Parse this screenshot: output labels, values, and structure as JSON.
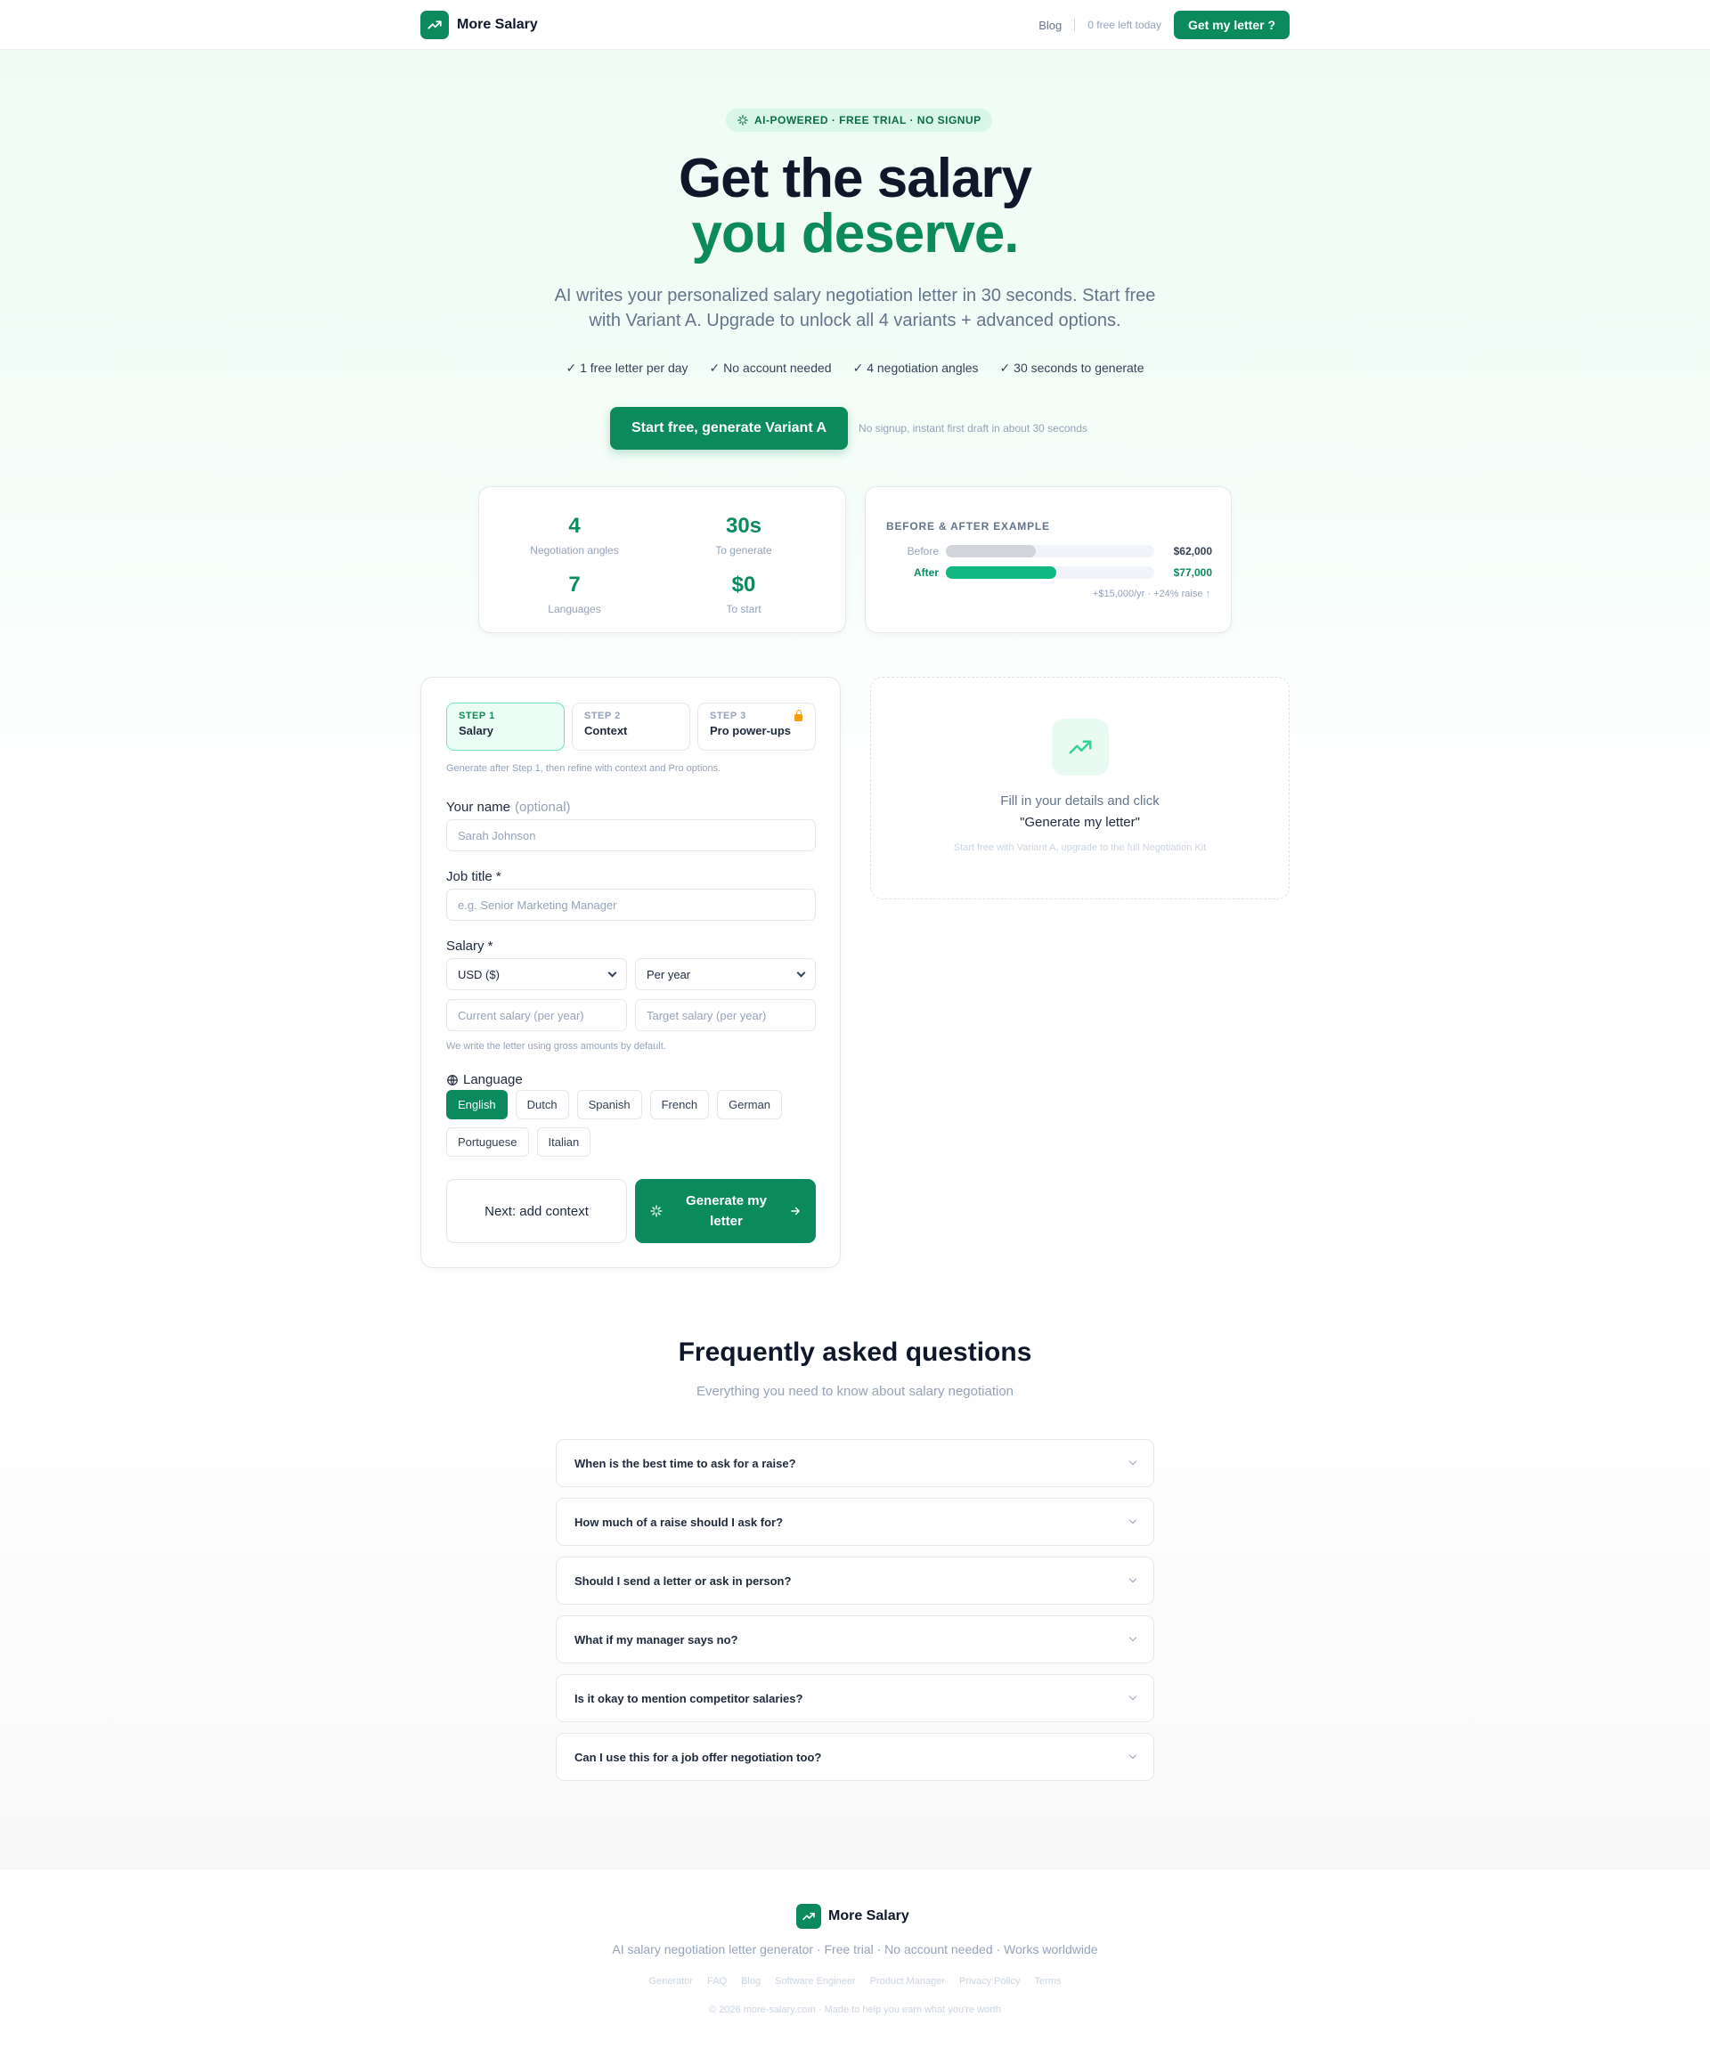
{
  "brand": {
    "name": "More Salary"
  },
  "nav": {
    "blog": "Blog",
    "free_left": "0 free left today",
    "cta": "Get my letter ?"
  },
  "hero": {
    "pill": "AI-POWERED · FREE TRIAL · NO SIGNUP",
    "title_line1": "Get the salary",
    "title_line2": "you deserve.",
    "subtitle": "AI writes your personalized salary negotiation letter in 30 seconds. Start free with Variant A. Upgrade to unlock all 4 variants + advanced options.",
    "checks": [
      "✓ 1 free letter per day",
      "✓ No account needed",
      "✓ 4 negotiation angles",
      "✓ 30 seconds to generate"
    ],
    "cta": "Start free, generate Variant A",
    "cta_note": "No signup, instant first draft in about 30 seconds"
  },
  "stats": [
    {
      "value": "4",
      "label": "Negotiation angles"
    },
    {
      "value": "30s",
      "label": "To generate"
    },
    {
      "value": "7",
      "label": "Languages"
    },
    {
      "value": "$0",
      "label": "To start"
    }
  ],
  "example": {
    "title": "BEFORE & AFTER EXAMPLE",
    "before_label": "Before",
    "before_value": "$62,000",
    "before_fill": 0.43,
    "before_color": "#d1d5db",
    "after_label": "After",
    "after_value": "$77,000",
    "after_fill": 0.53,
    "after_color": "#10b981",
    "note": "+$15,000/yr · +24% raise ↑"
  },
  "form": {
    "steps": [
      {
        "num": "STEP 1",
        "title": "Salary"
      },
      {
        "num": "STEP 2",
        "title": "Context"
      },
      {
        "num": "STEP 3",
        "title": "Pro power-ups"
      }
    ],
    "hint": "Generate after Step 1, then refine with context and Pro options.",
    "name_label": "Your name",
    "name_optional": "(optional)",
    "name_placeholder": "Sarah Johnson",
    "job_label": "Job title *",
    "job_placeholder": "e.g. Senior Marketing Manager",
    "salary_label": "Salary *",
    "currency": "USD ($)",
    "period": "Per year",
    "current_placeholder": "Current salary (per year)",
    "target_placeholder": "Target salary (per year)",
    "gross_note": "We write the letter using gross amounts by default.",
    "language_label": "Language",
    "languages": [
      "English",
      "Dutch",
      "Spanish",
      "French",
      "German",
      "Portuguese",
      "Italian"
    ],
    "next_button": "Next: add context",
    "generate_button": "Generate my letter"
  },
  "result": {
    "line1": "Fill in your details and click",
    "line2": "\"Generate my letter\"",
    "line3": "Start free with Variant A, upgrade to the full Negotiation Kit"
  },
  "faq": {
    "title": "Frequently asked questions",
    "subtitle": "Everything you need to know about salary negotiation",
    "items": [
      "When is the best time to ask for a raise?",
      "How much of a raise should I ask for?",
      "Should I send a letter or ask in person?",
      "What if my manager says no?",
      "Is it okay to mention competitor salaries?",
      "Can I use this for a job offer negotiation too?"
    ]
  },
  "footer": {
    "brand": "More Salary",
    "tagline": "AI salary negotiation letter generator · Free trial · No account needed · Works worldwide",
    "links": [
      "Generator",
      "FAQ",
      "Blog",
      "Software Engineer",
      "Product Manager",
      "Privacy Policy",
      "Terms"
    ],
    "copyright": "© 2026 more-salary.com · Made to help you earn what you're worth"
  },
  "colors": {
    "accent": "#0b8a5e",
    "accent_light": "#ecfdf5"
  }
}
